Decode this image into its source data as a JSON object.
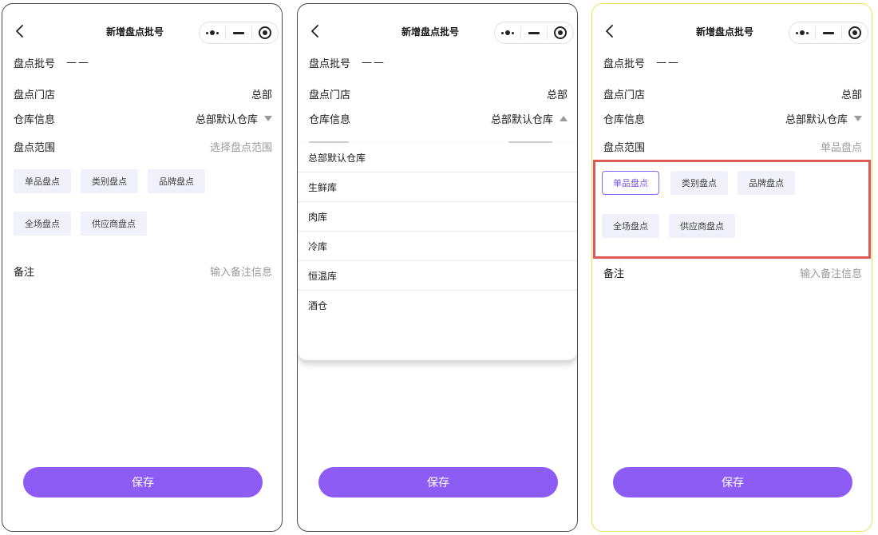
{
  "nav": {
    "title": "新增盘点批号"
  },
  "form": {
    "batch_label": "盘点批号",
    "batch_value": "——",
    "store_label": "盘点门店",
    "store_value": "总部",
    "warehouse_label": "仓库信息",
    "warehouse_value": "总部默认仓库",
    "scope_label": "盘点范围",
    "scope_placeholder": "选择盘点范围",
    "scope_selected": "单品盘点",
    "remark_label": "备注",
    "remark_placeholder": "输入备注信息"
  },
  "scope_options": [
    "单品盘点",
    "类别盘点",
    "品牌盘点",
    "全场盘点",
    "供应商盘点"
  ],
  "warehouse_options": [
    "总部默认仓库",
    "生鲜库",
    "肉库",
    "冷库",
    "恒温库",
    "酒仓"
  ],
  "save_label": "保存",
  "colors": {
    "accent": "#8c5cf5",
    "chip_bg": "#f1f1fc",
    "highlight": "#e05a55"
  },
  "icons": {
    "back": "chevron-left-icon",
    "more": "more-dots-icon",
    "minimize": "minimize-icon",
    "close": "target-circle-icon"
  }
}
